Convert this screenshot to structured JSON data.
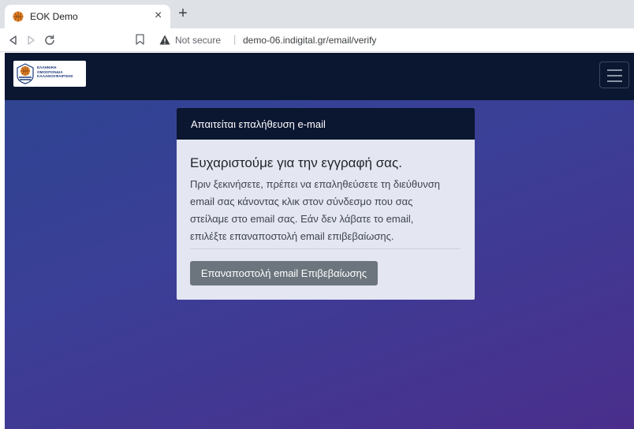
{
  "browser": {
    "tab_title": "EOK Demo",
    "close_symbol": "×",
    "new_tab_symbol": "+",
    "security_label": "Not secure",
    "separator": "|",
    "url": "demo-06.indigital.gr/email/verify",
    "icons": [
      "back-icon",
      "forward-icon",
      "reload-icon",
      "bookmark-icon",
      "warning-icon"
    ]
  },
  "navbar": {
    "logo_lines": [
      "ΕΛΛΗΝΙΚΗ",
      "ΟΜΟΣΠΟΝΔΙΑ",
      "ΚΑΛΑΘΟΣΦΑΙΡΙΣΗΣ"
    ],
    "menu_icon": "hamburger-icon"
  },
  "card": {
    "header": "Απαιτείται επαλήθευση e-mail",
    "title": "Ευχαριστούμε για την εγγραφή σας.",
    "lines": [
      "Πριν ξεκινήσετε, πρέπει να επαληθεύσετε τη διεύθυνση",
      "email σας κάνοντας κλικ στον σύνδεσμο που σας",
      "στείλαμε στο email σας. Εάν δεν λάβατε το email,",
      "επιλέξτε επαναποστολή email επιβεβαίωσης."
    ],
    "button_label": "Επαναποστολή email Επιβεβαίωσης"
  },
  "colors": {
    "navbar": "#0b1631",
    "card_bg": "#e4e6f1",
    "button": "#6c757d",
    "gradient_start": "#2d4591",
    "gradient_end": "#4a2e8c"
  }
}
